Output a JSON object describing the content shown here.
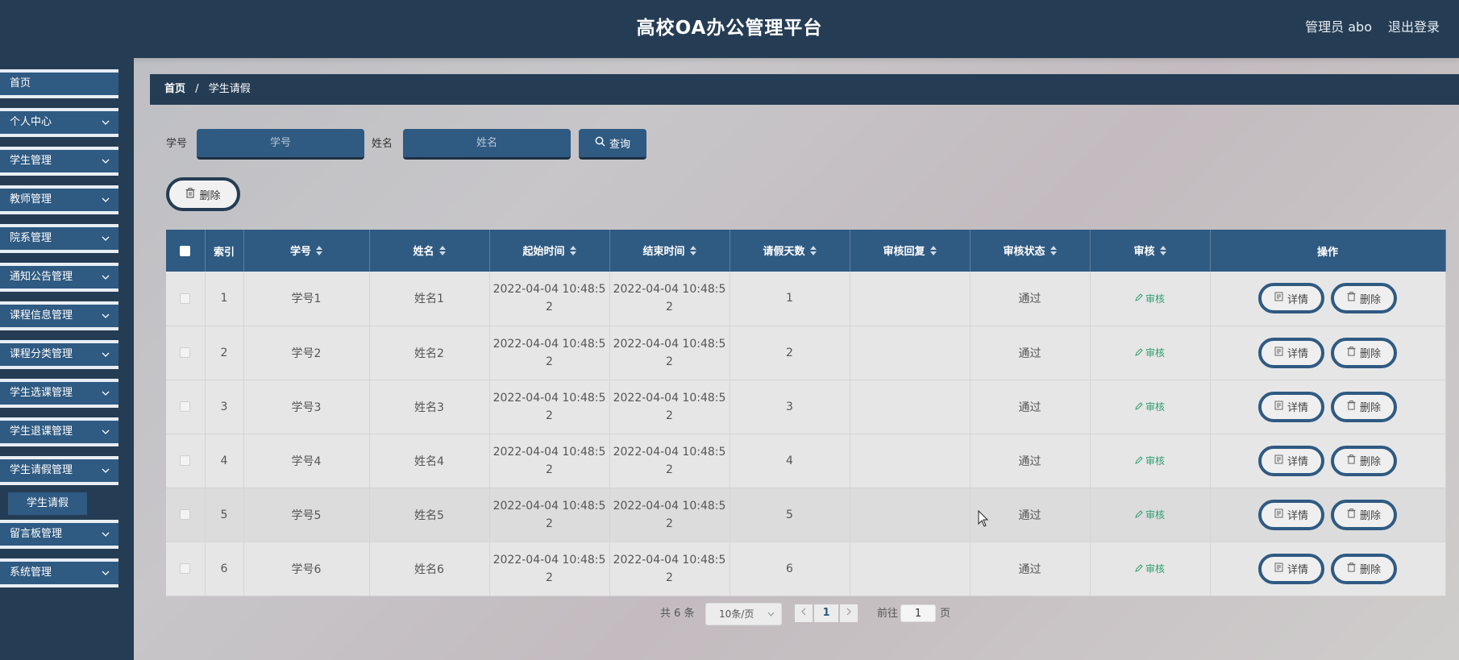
{
  "header": {
    "title": "高校OA办公管理平台",
    "user": "管理员 abo",
    "logout": "退出登录"
  },
  "sidebar": {
    "items": [
      {
        "label": "首页",
        "expandable": false
      },
      {
        "label": "个人中心",
        "expandable": true
      },
      {
        "label": "学生管理",
        "expandable": true
      },
      {
        "label": "教师管理",
        "expandable": true
      },
      {
        "label": "院系管理",
        "expandable": true
      },
      {
        "label": "通知公告管理",
        "expandable": true
      },
      {
        "label": "课程信息管理",
        "expandable": true
      },
      {
        "label": "课程分类管理",
        "expandable": true
      },
      {
        "label": "学生选课管理",
        "expandable": true
      },
      {
        "label": "学生退课管理",
        "expandable": true
      },
      {
        "label": "学生请假管理",
        "expandable": true
      },
      {
        "label": "留言板管理",
        "expandable": true
      },
      {
        "label": "系统管理",
        "expandable": true
      }
    ],
    "active_sub": "学生请假"
  },
  "breadcrumb": {
    "home": "首页",
    "sep": "/",
    "current": "学生请假"
  },
  "search": {
    "student_no_label": "学号",
    "student_no_placeholder": "学号",
    "name_label": "姓名",
    "name_placeholder": "姓名",
    "query_button": "查询"
  },
  "bulk_delete": "删除",
  "table": {
    "columns": [
      "索引",
      "学号",
      "姓名",
      "起始时间",
      "结束时间",
      "请假天数",
      "审核回复",
      "审核状态",
      "审核",
      "操作"
    ],
    "rows": [
      {
        "index": "1",
        "no": "学号1",
        "name": "姓名1",
        "start": "2022-04-04 10:48:52",
        "end": "2022-04-04 10:48:52",
        "days": "1",
        "reply": "",
        "status": "通过"
      },
      {
        "index": "2",
        "no": "学号2",
        "name": "姓名2",
        "start": "2022-04-04 10:48:52",
        "end": "2022-04-04 10:48:52",
        "days": "2",
        "reply": "",
        "status": "通过"
      },
      {
        "index": "3",
        "no": "学号3",
        "name": "姓名3",
        "start": "2022-04-04 10:48:52",
        "end": "2022-04-04 10:48:52",
        "days": "3",
        "reply": "",
        "status": "通过"
      },
      {
        "index": "4",
        "no": "学号4",
        "name": "姓名4",
        "start": "2022-04-04 10:48:52",
        "end": "2022-04-04 10:48:52",
        "days": "4",
        "reply": "",
        "status": "通过"
      },
      {
        "index": "5",
        "no": "学号5",
        "name": "姓名5",
        "start": "2022-04-04 10:48:52",
        "end": "2022-04-04 10:48:52",
        "days": "5",
        "reply": "",
        "status": "通过"
      },
      {
        "index": "6",
        "no": "学号6",
        "name": "姓名6",
        "start": "2022-04-04 10:48:52",
        "end": "2022-04-04 10:48:52",
        "days": "6",
        "reply": "",
        "status": "通过"
      }
    ],
    "audit_link": "审核",
    "detail_button": "详情",
    "delete_button": "删除"
  },
  "pagination": {
    "total": "共 6 条",
    "page_size": "10条/页",
    "current_page": "1",
    "goto_label": "前往",
    "goto_value": "1",
    "page_suffix": "页"
  },
  "colors": {
    "header_bg": "#253d54",
    "accent": "#2f5a82",
    "audit_green": "#2e9e6f"
  }
}
